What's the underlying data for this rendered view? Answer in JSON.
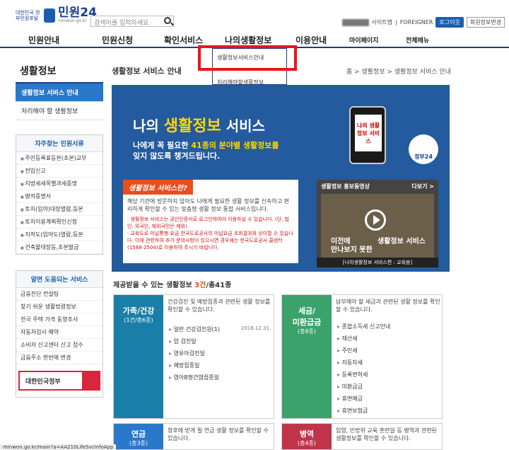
{
  "header": {
    "logo_small": "대한민국\n정부민원포털",
    "logo_main": "민원24",
    "logo_url": "minwon.go.kr",
    "search_placeholder": "검색어를 입력하세요",
    "util_sitemap": "사이트맵",
    "util_foreigner": "FOREIGNER",
    "login": "로그이웃",
    "signup": "회원정보변경"
  },
  "gnb": {
    "items": [
      "민원안내",
      "민원신청",
      "확인서비스",
      "나의생활정보",
      "이용안내"
    ],
    "mypage": "마이페이지",
    "allmenu": "전체메뉴"
  },
  "dropdown": {
    "items": [
      "생활정보서비스안내",
      "처리해야할생활정보"
    ]
  },
  "leftnav": {
    "title": "생활정보",
    "items": [
      "생활정보 서비스 안내",
      "처리해야 할 생활정보"
    ]
  },
  "faq": {
    "title": "자주찾는 민원서류",
    "items": [
      "주민등록표등본(초본)교부",
      "전입신고",
      "지방세세목별과세증명",
      "병적증명서",
      "토지(임야)대장열람,등본",
      "토지이용계획확인신청",
      "지적도(임야도)열람,등본",
      "건축물대장등,초본발급"
    ]
  },
  "helpful": {
    "title": "알면 도움되는 서비스",
    "items": [
      "금융진단 컨설팅",
      "찾기 쉬운 생활법령정보",
      "전국 주택 가격 동향조사",
      "자동차검사 예약",
      "소비자 신고센터 신고 접수",
      "금융주소 한번에 변경"
    ]
  },
  "gov_search": "대한민국정부",
  "content": {
    "title": "생활정보 서비스 안내",
    "breadcrumb": "홈 > 생활정보 > 생활정보 서비스 안내"
  },
  "banner": {
    "prefix": "나의",
    "highlight": "생활정보",
    "suffix": "서비스",
    "line1_pre": "나에게 꼭 필요한",
    "line1_em": "41종의 분야별 생활정보를",
    "line2": "잊지 않도록 챙겨드립니다.",
    "phone_text": "나의 생활정보 서비스",
    "gov24": "정부24",
    "panel_title": "생활정보 서비스란?",
    "panel_text": "해당 기관에 방문하지 않아도 나에게 필요한 생활 정보를 신속하고 편리하게 확인할 수 있는 맞춤형 생활 정보 통합 서비스입니다.",
    "panel_red1": "· 생활정보 서비스는 공인인증서로 로그인하여야 이용하실 수 있습니다. (단, 법인, 외국인, 재외국민은 제외)",
    "panel_red2": "· 교육도로 미납통행 요금 한국도로공사의 미납요금 조회결과와 상이할 수 있습니다. 이에 관련하여 추가 문의사항이 있으시면 경우에는 한국도로공사 콜센터(1588-2504)로 이용하여 주시기 바랍니다.",
    "video_title": "생활정보 홍보동영상",
    "video_more": "다보기 >",
    "video_left": "이전에\n만나보지 못한",
    "video_right": "생활정보 서비스",
    "video_caption": "[나의생활정보 서비스편 : 교육용]"
  },
  "count": {
    "pre": "제공받을 수 있는 생활정보",
    "em": "3건",
    "post": "/총41종"
  },
  "cards": [
    {
      "title": "가족/건강",
      "sub": "(1건/총6종)",
      "desc": "건강검진 및 예방접종과 관련된 생활 정보를 확인할 수 있습니다.",
      "items": [
        "일반 건강검진원(1)",
        "암 검진일",
        "영유아검진일",
        "예방접종일",
        "영아B형간염접종일"
      ],
      "date": "2018.12.31."
    },
    {
      "title": "세금/",
      "title2": "미환급금",
      "sub": "(총8종)",
      "desc": "납부해야 할 세금과 관련된 생활 정보를 확인할 수 있습니다.",
      "items": [
        "종합소득세 신고안내",
        "재산세",
        "주민세",
        "자동차세",
        "등록면허세",
        "미환급금",
        "휴면예금",
        "휴면보험금"
      ]
    },
    {
      "title": "연금",
      "sub": "(총3종)",
      "desc": "향후에 받게 될 연금 생활 정보를 확인할 수 있습니다."
    },
    {
      "title": "병역",
      "sub": "(총4종)",
      "desc": "입영, 민방위 교육 훈련일 등 병역과 관련된 생활정보를 확인할 수 있습니다."
    }
  ],
  "status_url": "minwon.go.kr/main?a=AA210LifeSvcInfoApp"
}
